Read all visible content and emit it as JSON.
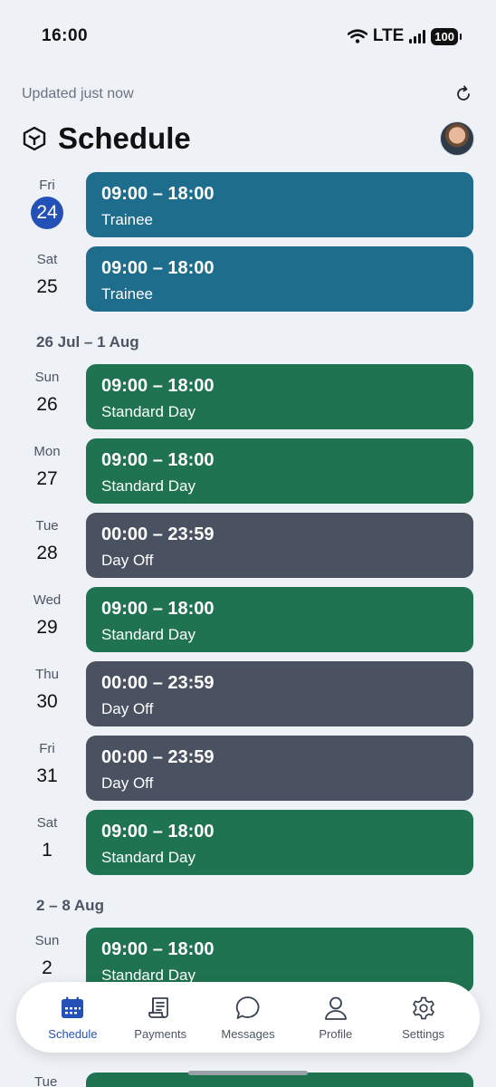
{
  "status_bar": {
    "time": "16:00",
    "network": "LTE",
    "battery": "100"
  },
  "updated_text": "Updated just now",
  "page_title": "Schedule",
  "colors": {
    "trainee": "#1e6d8c",
    "standard": "#1f7350",
    "day_off": "#4a5160",
    "accent": "#2451b7"
  },
  "groups": [
    {
      "heading": "",
      "days": [
        {
          "dow": "Fri",
          "day": "24",
          "today": true,
          "time": "09:00 – 18:00",
          "type": "Trainee",
          "kind": "trainee"
        },
        {
          "dow": "Sat",
          "day": "25",
          "today": false,
          "time": "09:00 – 18:00",
          "type": "Trainee",
          "kind": "trainee"
        }
      ]
    },
    {
      "heading": "26 Jul – 1 Aug",
      "days": [
        {
          "dow": "Sun",
          "day": "26",
          "today": false,
          "time": "09:00 – 18:00",
          "type": "Standard Day",
          "kind": "standard"
        },
        {
          "dow": "Mon",
          "day": "27",
          "today": false,
          "time": "09:00 – 18:00",
          "type": "Standard Day",
          "kind": "standard"
        },
        {
          "dow": "Tue",
          "day": "28",
          "today": false,
          "time": "00:00 – 23:59",
          "type": "Day Off",
          "kind": "day_off"
        },
        {
          "dow": "Wed",
          "day": "29",
          "today": false,
          "time": "09:00 – 18:00",
          "type": "Standard Day",
          "kind": "standard"
        },
        {
          "dow": "Thu",
          "day": "30",
          "today": false,
          "time": "00:00 – 23:59",
          "type": "Day Off",
          "kind": "day_off"
        },
        {
          "dow": "Fri",
          "day": "31",
          "today": false,
          "time": "00:00 – 23:59",
          "type": "Day Off",
          "kind": "day_off"
        },
        {
          "dow": "Sat",
          "day": "1",
          "today": false,
          "time": "09:00 – 18:00",
          "type": "Standard Day",
          "kind": "standard"
        }
      ]
    },
    {
      "heading": "2 – 8 Aug",
      "days": [
        {
          "dow": "Sun",
          "day": "2",
          "today": false,
          "time": "09:00 – 18:00",
          "type": "Standard Day",
          "kind": "standard"
        }
      ]
    }
  ],
  "partial_next_day": {
    "dow": "Tue"
  },
  "nav": [
    {
      "label": "Schedule",
      "icon": "calendar-icon",
      "active": true
    },
    {
      "label": "Payments",
      "icon": "receipt-icon",
      "active": false
    },
    {
      "label": "Messages",
      "icon": "chat-bubble-icon",
      "active": false
    },
    {
      "label": "Profile",
      "icon": "person-icon",
      "active": false
    },
    {
      "label": "Settings",
      "icon": "gear-icon",
      "active": false
    }
  ]
}
